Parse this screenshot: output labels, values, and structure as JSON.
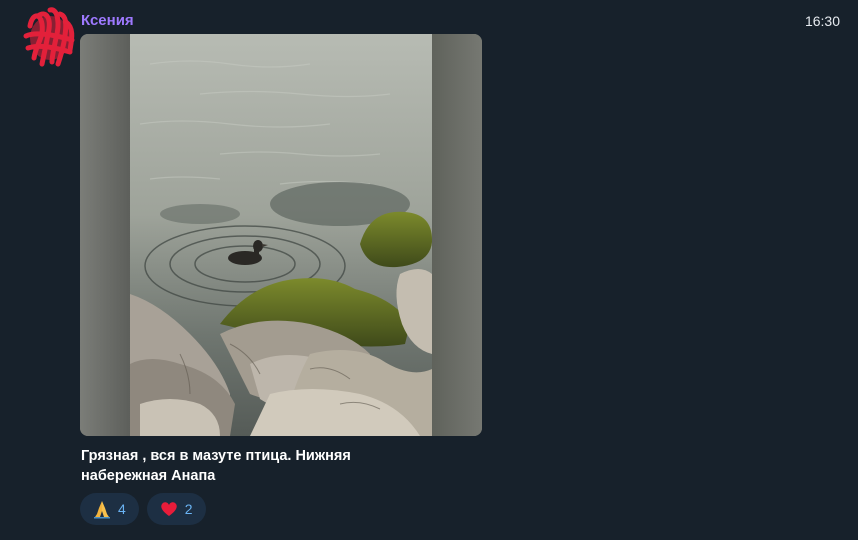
{
  "message": {
    "author": "Ксения",
    "time": "16:30",
    "caption_line1": "Грязная , вся в мазуте птица. Нижняя",
    "caption_line2": "набережная Анапа",
    "media_icon": "photo-duck-on-rocks"
  },
  "reactions": [
    {
      "icon": "praying-hands-icon",
      "count": "4"
    },
    {
      "icon": "heart-icon",
      "count": "2"
    }
  ],
  "colors": {
    "background": "#17212b",
    "author": "#9e79ff",
    "reaction_bg": "#1d2f43",
    "reaction_count": "#6ab3f3"
  }
}
